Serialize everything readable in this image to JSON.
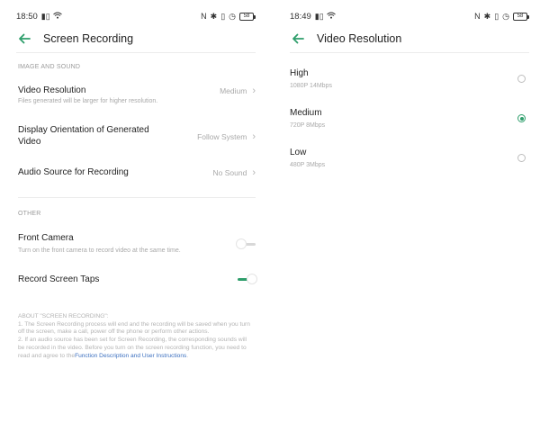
{
  "left": {
    "status": {
      "time": "18:50",
      "battery": "58"
    },
    "header": {
      "title": "Screen Recording"
    },
    "section_image_sound": "IMAGE AND SOUND",
    "video_resolution": {
      "title": "Video Resolution",
      "subtitle": "Files generated will be larger for higher resolution.",
      "value": "Medium"
    },
    "display_orientation": {
      "title_line1": "Display Orientation of Generated",
      "title_line2": "Video",
      "value": "Follow System"
    },
    "audio_source": {
      "title": "Audio Source for Recording",
      "value": "No Sound"
    },
    "section_other": "OTHER",
    "front_camera": {
      "title": "Front Camera",
      "subtitle": "Turn on the front camera to record video at the same time.",
      "state": "off"
    },
    "record_taps": {
      "title": "Record Screen Taps",
      "state": "on"
    },
    "about": {
      "heading": "ABOUT \"SCREEN RECORDING\":",
      "p1": "1. The Screen Recording process will end and the recording will be saved when you turn off the screen, make a call, power off the phone or perform other actions.",
      "p2": "2. If an audio source has been set for Screen Recording, the corresponding sounds will be recorded in the video. Before you turn on the screen recording function, you need to read and agree to the",
      "link": "Function Description and User Instructions",
      "end": "."
    }
  },
  "right": {
    "status": {
      "time": "18:49",
      "battery": "58"
    },
    "header": {
      "title": "Video Resolution"
    },
    "options": [
      {
        "label": "High",
        "detail": "1080P 14Mbps",
        "selected": false
      },
      {
        "label": "Medium",
        "detail": "720P 8Mbps",
        "selected": true
      },
      {
        "label": "Low",
        "detail": "480P 3Mbps",
        "selected": false
      }
    ]
  },
  "colors": {
    "accent": "#2e9e6b",
    "link": "#3b6fbf",
    "muted": "#a9a9a9"
  },
  "icons": [
    "back-arrow-icon",
    "chevron-right-icon",
    "wifi-icon",
    "signal-icon",
    "nfc-icon",
    "bluetooth-icon",
    "vibrate-icon",
    "battery-icon"
  ]
}
